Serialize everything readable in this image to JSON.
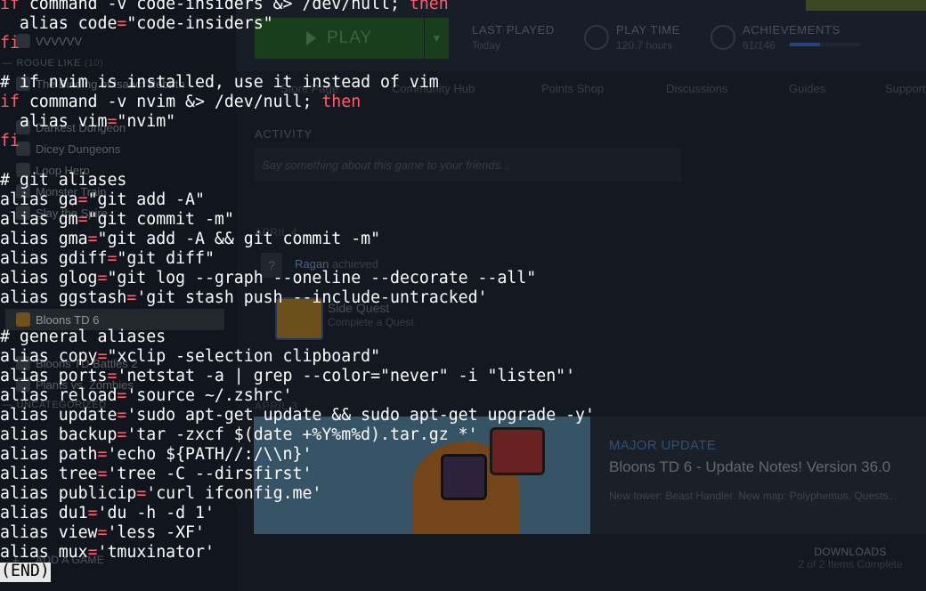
{
  "steam": {
    "sidebar": {
      "items": [
        {
          "label": "VVVVVV"
        },
        {
          "label": "The Binding of Isaac: Rebirth"
        },
        {
          "label": "Darkest Dungeon"
        },
        {
          "label": "Dicey Dungeons"
        },
        {
          "label": "Loop Hero"
        },
        {
          "label": "Monster Train"
        },
        {
          "label": "Slay the Spire"
        },
        {
          "label": "Bloons TD 6"
        },
        {
          "label": "Bloons TD Battles 2"
        },
        {
          "label": "Plants vs. Zombies"
        }
      ],
      "section_roguelike": {
        "label": "ROGUE LIKE",
        "count": "(10)"
      },
      "section_uncategorized": {
        "label": "UNCATEGORIZED"
      },
      "add_game_label": "ADD A GAME",
      "add_game_plus": "+"
    },
    "header": {
      "play_label": "PLAY",
      "last_played_label": "LAST PLAYED",
      "last_played_value": "Today",
      "play_time_label": "PLAY TIME",
      "play_time_value": "120.7 hours",
      "achievements_label": "ACHIEVEMENTS",
      "achievements_value": "61/146",
      "achievements_progress": 0.42
    },
    "tabs": [
      {
        "label": "Store Page"
      },
      {
        "label": "Community Hub"
      },
      {
        "label": "Points Shop"
      },
      {
        "label": "Discussions"
      },
      {
        "label": "Guides"
      },
      {
        "label": "Support"
      }
    ],
    "activity": {
      "label": "ACTIVITY",
      "placeholder": "Say something about this game to your friends...",
      "date_1": "APRIL 4",
      "feed_user": "Ragan",
      "feed_action": "achieved",
      "quest_title": "Side Quest",
      "quest_desc": "Complete a Quest",
      "date_2": "APRIL 3"
    },
    "news": {
      "kind": "MAJOR UPDATE",
      "title": "Bloons TD 6 - Update Notes! Version 36.0",
      "desc": "New tower: Beast Handler. New map: Polyphemus. Quests..."
    },
    "downloads": {
      "label": "DOWNLOADS",
      "status": "2 of 2 Items Complete"
    }
  },
  "terminal": {
    "lines": [
      {
        "pre": "if",
        "mid": " command -v code-insiders &> /dev/null; ",
        "post": "then"
      },
      {
        "text": "  alias code=\"code-insiders\""
      },
      {
        "kw": "fi"
      },
      {
        "text": ""
      },
      {
        "text": "# if nvim is installed, use it instead of vim"
      },
      {
        "pre": "if",
        "mid": " command -v nvim &> /dev/null; ",
        "post": "then"
      },
      {
        "text": "  alias vim=\"nvim\""
      },
      {
        "kw": "fi"
      },
      {
        "text": ""
      },
      {
        "text": "# git aliases"
      },
      {
        "text": "alias ga=\"git add -A\""
      },
      {
        "text": "alias gm=\"git commit -m\""
      },
      {
        "text": "alias gma=\"git add -A && git commit -m\""
      },
      {
        "text": "alias gdiff=\"git diff\""
      },
      {
        "text": "alias glog=\"git log --graph --oneline --decorate --all\""
      },
      {
        "text": "alias ggstash='git stash push --include-untracked'"
      },
      {
        "text": ""
      },
      {
        "text": "# general aliases"
      },
      {
        "text": "alias copy=\"xclip -selection clipboard\""
      },
      {
        "text": "alias ports='netstat -a | grep --color=\"never\" -i \"listen\"'"
      },
      {
        "text": "alias reload='source ~/.zshrc'"
      },
      {
        "text": "alias update='sudo apt-get update && sudo apt-get upgrade -y'"
      },
      {
        "text": "alias backup='tar -zxcf $(date +%Y%m%d).tar.gz *'"
      },
      {
        "text": "alias path='echo ${PATH//:/\\\\n}'"
      },
      {
        "text": "alias tree='tree -C --dirsfirst'"
      },
      {
        "text": "alias publicip='curl ifconfig.me'"
      },
      {
        "text": "alias du1='du -h -d 1'"
      },
      {
        "text": "alias view='less -XF'"
      },
      {
        "text": "alias mux='tmuxinator'"
      }
    ],
    "end_marker": "(END)",
    "colors": {
      "keyword": "#ff5f6d",
      "text": "#ffffff"
    }
  }
}
